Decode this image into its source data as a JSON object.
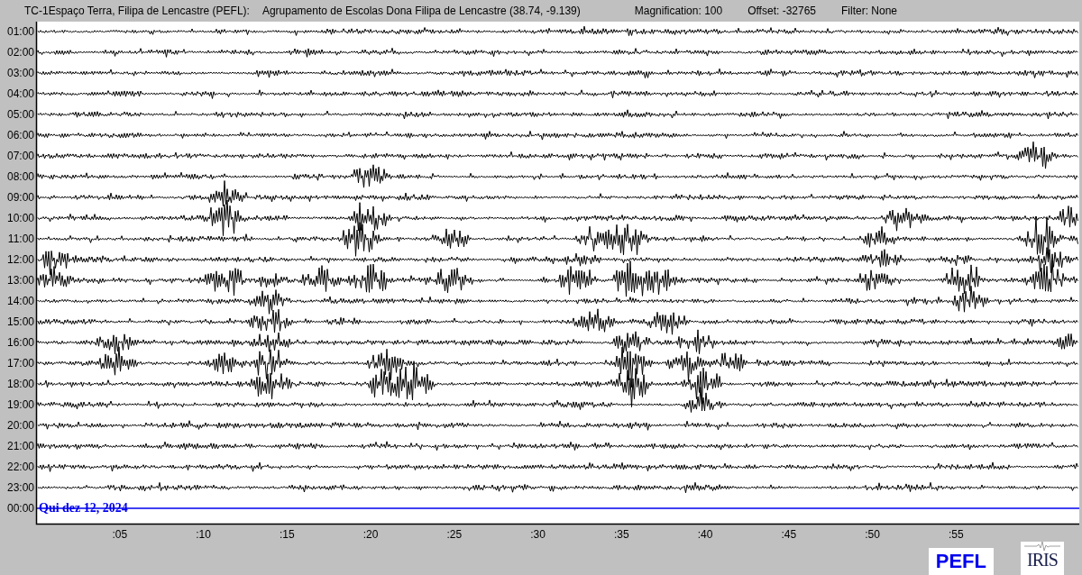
{
  "header": {
    "station": "TC-1Espaço Terra, Filipa de Lencastre (PEFL):",
    "location": "Agrupamento de Escolas Dona Filipa de Lencastre (38.74, -9.139)",
    "magnification": "Magnification: 100",
    "offset": "Offset: -32765",
    "filter": "Filter: None"
  },
  "rows": [
    {
      "time": "01:00",
      "kind": "trace"
    },
    {
      "time": "02:00",
      "kind": "trace"
    },
    {
      "time": "03:00",
      "kind": "trace"
    },
    {
      "time": "04:00",
      "kind": "trace"
    },
    {
      "time": "05:00",
      "kind": "trace"
    },
    {
      "time": "06:00",
      "kind": "trace"
    },
    {
      "time": "07:00",
      "kind": "trace"
    },
    {
      "time": "08:00",
      "kind": "trace"
    },
    {
      "time": "09:00",
      "kind": "trace"
    },
    {
      "time": "10:00",
      "kind": "trace"
    },
    {
      "time": "11:00",
      "kind": "trace"
    },
    {
      "time": "12:00",
      "kind": "trace"
    },
    {
      "time": "13:00",
      "kind": "trace"
    },
    {
      "time": "14:00",
      "kind": "trace"
    },
    {
      "time": "15:00",
      "kind": "trace"
    },
    {
      "time": "16:00",
      "kind": "trace"
    },
    {
      "time": "17:00",
      "kind": "trace"
    },
    {
      "time": "18:00",
      "kind": "trace"
    },
    {
      "time": "19:00",
      "kind": "trace"
    },
    {
      "time": "20:00",
      "kind": "trace"
    },
    {
      "time": "21:00",
      "kind": "trace"
    },
    {
      "time": "22:00",
      "kind": "trace"
    },
    {
      "time": "23:00",
      "kind": "trace"
    },
    {
      "time": "00:00",
      "kind": "current"
    }
  ],
  "date_label": "Qui dez 12, 2024",
  "x_ticks": [
    ":05",
    ":10",
    ":15",
    ":20",
    ":25",
    ":30",
    ":35",
    ":40",
    ":45",
    ":50",
    ":55"
  ],
  "station_badge": "PEFL",
  "logo": "IRIS"
}
